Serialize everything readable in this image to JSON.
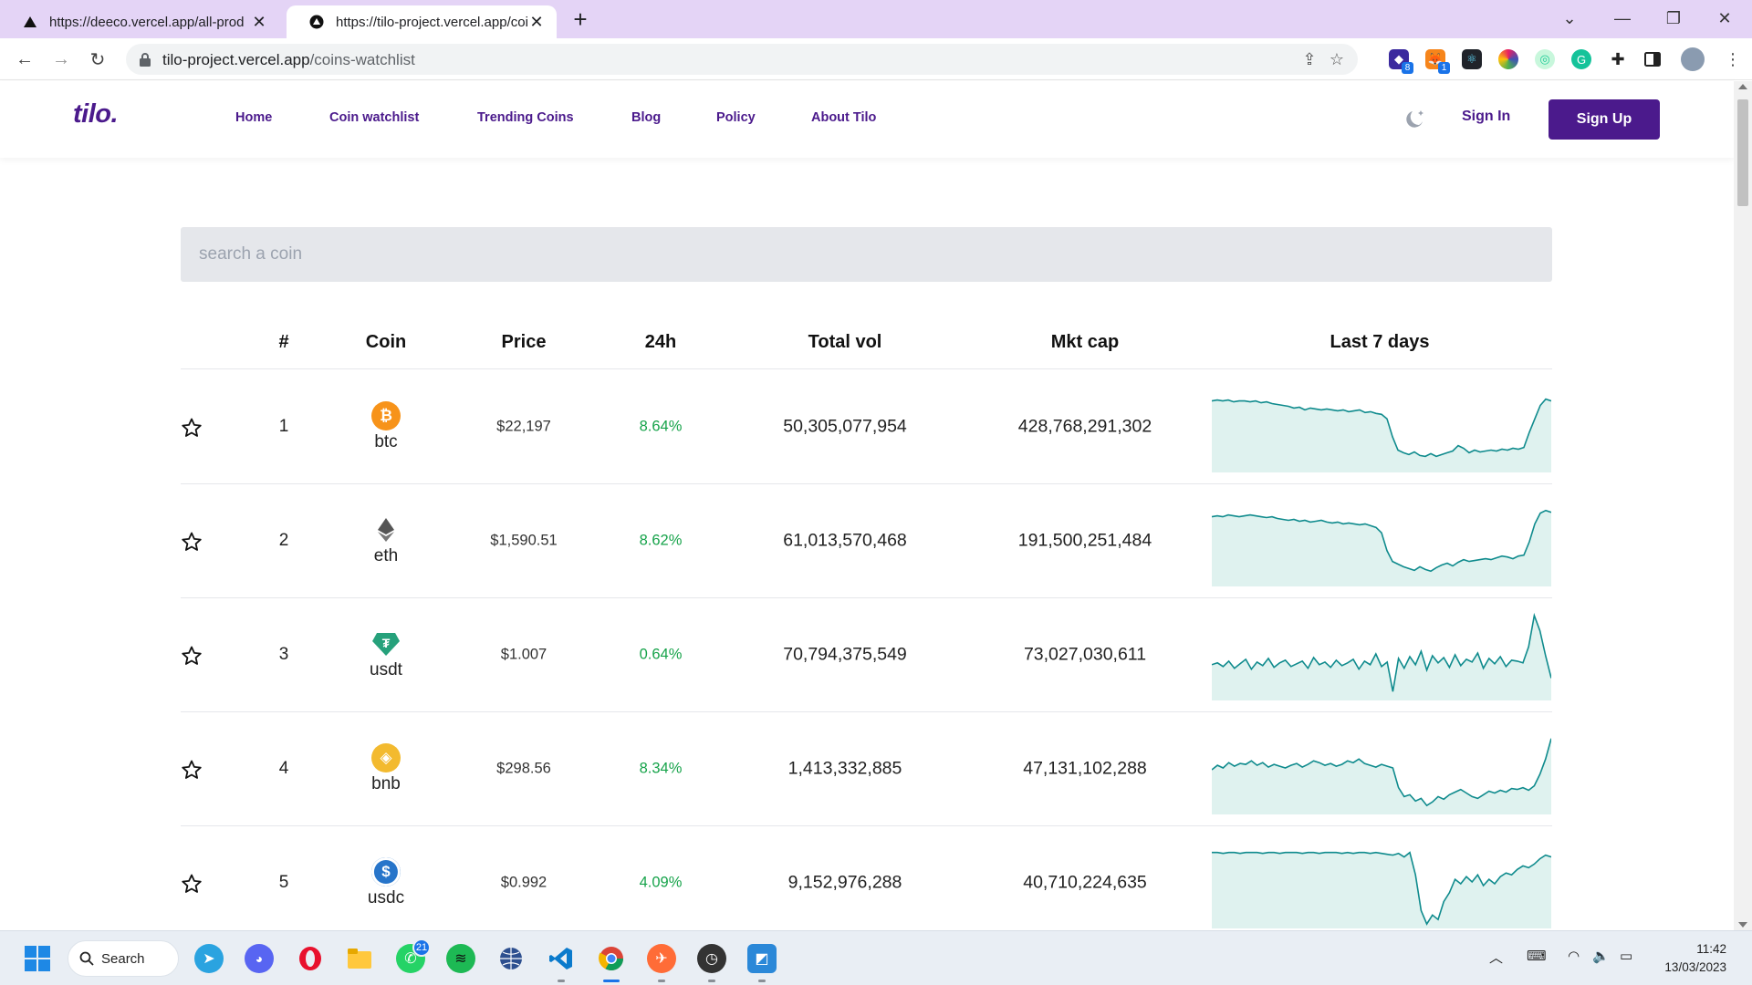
{
  "browser": {
    "tabs": [
      {
        "title": "https://deeco.vercel.app/all-prod",
        "active": false
      },
      {
        "title": "https://tilo-project.vercel.app/coi",
        "active": true
      }
    ],
    "url_host": "tilo-project.vercel.app",
    "url_path": "/coins-watchlist",
    "extensions": [
      "capgo-icon",
      "metamask-icon",
      "react-devtools-icon",
      "colorzilla-icon",
      "ext-icon",
      "grammarly-icon",
      "puzzle-icon",
      "sidepanel-icon",
      "profile-avatar"
    ],
    "extension_badges": {
      "capgo": "8",
      "metamask": "1"
    }
  },
  "site": {
    "logo": "tilo.",
    "nav": [
      "Home",
      "Coin watchlist",
      "Trending Coins",
      "Blog",
      "Policy",
      "About Tilo"
    ],
    "sign_in": "Sign In",
    "sign_up": "Sign Up",
    "brand_color": "#4b1a8c"
  },
  "search": {
    "placeholder": "search a coin",
    "value": ""
  },
  "table": {
    "headers": [
      "#",
      "Coin",
      "Price",
      "24h",
      "Total vol",
      "Mkt cap",
      "Last 7 days"
    ],
    "rows": [
      {
        "rank": "1",
        "symbol": "btc",
        "icon": "bitcoin-icon",
        "color": "#f7931a",
        "price": "$22,197",
        "change": "8.64%",
        "volume": "50,305,077,954",
        "mcap": "428,768,291,302",
        "spark": [
          80,
          81,
          80,
          81,
          79,
          80,
          80,
          79,
          80,
          78,
          79,
          77,
          76,
          75,
          74,
          72,
          73,
          70,
          72,
          71,
          70,
          71,
          70,
          69,
          70,
          68,
          69,
          70,
          67,
          68,
          66,
          65,
          60,
          40,
          25,
          22,
          20,
          23,
          19,
          18,
          21,
          18,
          20,
          22,
          24,
          30,
          27,
          22,
          25,
          23,
          24,
          25,
          24,
          26,
          25,
          27,
          26,
          28,
          45,
          60,
          75,
          82,
          80
        ]
      },
      {
        "rank": "2",
        "symbol": "eth",
        "icon": "ethereum-icon",
        "color": "#627eea",
        "price": "$1,590.51",
        "change": "8.62%",
        "volume": "61,013,570,468",
        "mcap": "191,500,251,484",
        "spark": [
          78,
          79,
          78,
          80,
          79,
          78,
          79,
          80,
          79,
          78,
          77,
          78,
          76,
          75,
          74,
          75,
          73,
          74,
          72,
          73,
          74,
          72,
          71,
          72,
          70,
          71,
          70,
          69,
          70,
          68,
          66,
          60,
          40,
          28,
          25,
          22,
          20,
          18,
          22,
          19,
          17,
          21,
          24,
          26,
          23,
          27,
          30,
          28,
          29,
          30,
          31,
          30,
          32,
          34,
          33,
          31,
          34,
          35,
          50,
          70,
          82,
          85,
          83
        ]
      },
      {
        "rank": "3",
        "symbol": "usdt",
        "icon": "tether-icon",
        "color": "#26a17b",
        "price": "$1.007",
        "change": "0.64%",
        "volume": "70,794,375,549",
        "mcap": "73,027,030,611",
        "spark": [
          40,
          42,
          38,
          44,
          36,
          41,
          46,
          35,
          43,
          39,
          47,
          37,
          42,
          45,
          38,
          41,
          44,
          36,
          48,
          40,
          43,
          37,
          45,
          39,
          42,
          46,
          35,
          44,
          40,
          52,
          38,
          43,
          10,
          47,
          36,
          49,
          40,
          55,
          34,
          50,
          42,
          48,
          37,
          51,
          39,
          46,
          43,
          53,
          36,
          47,
          41,
          49,
          38,
          45,
          44,
          42,
          60,
          95,
          78,
          50,
          25
        ]
      },
      {
        "rank": "4",
        "symbol": "bnb",
        "icon": "bnb-icon",
        "color": "#f3ba2f",
        "price": "$298.56",
        "change": "8.34%",
        "volume": "1,413,332,885",
        "mcap": "47,131,102,288",
        "spark": [
          50,
          55,
          52,
          58,
          54,
          57,
          56,
          60,
          55,
          58,
          53,
          56,
          54,
          52,
          55,
          57,
          53,
          56,
          60,
          58,
          55,
          57,
          54,
          56,
          60,
          58,
          62,
          57,
          55,
          53,
          56,
          54,
          52,
          30,
          20,
          22,
          15,
          18,
          10,
          14,
          20,
          17,
          22,
          25,
          28,
          24,
          20,
          18,
          22,
          26,
          24,
          27,
          25,
          29,
          28,
          30,
          27,
          32,
          45,
          62,
          85
        ]
      },
      {
        "rank": "5",
        "symbol": "usdc",
        "icon": "usdc-icon",
        "color": "#2775ca",
        "price": "$0.992",
        "change": "4.09%",
        "volume": "9,152,976,288",
        "mcap": "40,710,224,635",
        "spark": [
          85,
          85,
          84,
          85,
          85,
          84,
          85,
          85,
          85,
          84,
          85,
          85,
          84,
          85,
          85,
          85,
          84,
          85,
          85,
          84,
          85,
          85,
          85,
          84,
          85,
          84,
          85,
          85,
          84,
          85,
          84,
          83,
          82,
          84,
          80,
          85,
          60,
          20,
          5,
          15,
          10,
          30,
          40,
          55,
          50,
          58,
          52,
          60,
          48,
          55,
          50,
          58,
          62,
          60,
          66,
          70,
          68,
          72,
          78,
          82,
          80
        ]
      }
    ]
  },
  "taskbar": {
    "search_label": "Search",
    "whatsapp_badge": "21",
    "time": "11:42",
    "date": "13/03/2023"
  }
}
